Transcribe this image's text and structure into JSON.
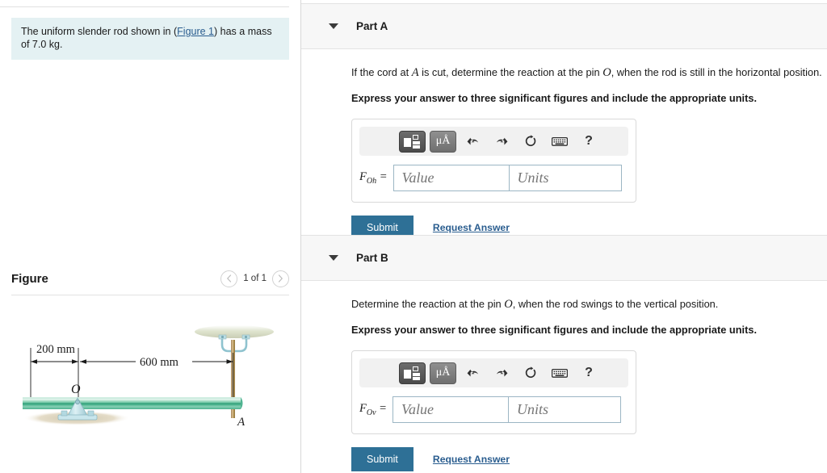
{
  "problem": {
    "text_before_link": "The uniform slender rod shown in (",
    "link_label": "Figure 1",
    "text_after_link": ") has a mass of 7.0 kg."
  },
  "figure_panel": {
    "title": "Figure",
    "prev_icon": "chevron-left-icon",
    "next_icon": "chevron-right-icon",
    "pager_text": "1 of 1"
  },
  "figure_diagram": {
    "dim_left_label": "200 mm",
    "dim_right_label": "600 mm",
    "pin_label": "O",
    "cord_label": "A"
  },
  "parts": [
    {
      "id": "part-a",
      "caret_icon": "caret-down-icon",
      "title": "Part A",
      "question_pre": "If the cord at ",
      "question_var1": "A",
      "question_mid": " is cut, determine the reaction at the pin ",
      "question_var2": "O",
      "question_post": ", when the rod is still in the horizontal position.",
      "instruction": "Express your answer to three significant figures and include the appropriate units.",
      "toolbar": {
        "template_icon": "math-template-icon",
        "units_icon": "micro-angstrom-units-icon",
        "units_label": "μÅ",
        "undo_icon": "undo-icon",
        "redo_icon": "redo-icon",
        "reset_icon": "reset-icon",
        "keyboard_icon": "keyboard-icon",
        "help_icon": "help-icon",
        "help_label": "?"
      },
      "answer_label_main": "F",
      "answer_label_sub": "Oh",
      "answer_label_eq": "=",
      "value_placeholder": "Value",
      "units_placeholder": "Units",
      "value_current": "",
      "units_current": "",
      "submit_label": "Submit",
      "request_label": "Request Answer"
    },
    {
      "id": "part-b",
      "caret_icon": "caret-down-icon",
      "title": "Part B",
      "question_pre": "Determine the reaction at the pin ",
      "question_var1": "",
      "question_mid": "",
      "question_var2": "O",
      "question_post": ", when the rod swings to the vertical position.",
      "instruction": "Express your answer to three significant figures and include the appropriate units.",
      "toolbar": {
        "template_icon": "math-template-icon",
        "units_icon": "micro-angstrom-units-icon",
        "units_label": "μÅ",
        "undo_icon": "undo-icon",
        "redo_icon": "redo-icon",
        "reset_icon": "reset-icon",
        "keyboard_icon": "keyboard-icon",
        "help_icon": "help-icon",
        "help_label": "?"
      },
      "answer_label_main": "F",
      "answer_label_sub": "Ov",
      "answer_label_eq": "=",
      "value_placeholder": "Value",
      "units_placeholder": "Units",
      "value_current": "",
      "units_current": "",
      "submit_label": "Submit",
      "request_label": "Request Answer"
    }
  ],
  "colors": {
    "problem_bg": "#e4f1f3",
    "link": "#2a5d8f",
    "submit_bg": "#2e7096",
    "part_header_bg": "#f7f7f7",
    "rod_green": "#5fbf9a",
    "cord_tan": "#bfa070",
    "support_blue": "#bcdde2"
  }
}
